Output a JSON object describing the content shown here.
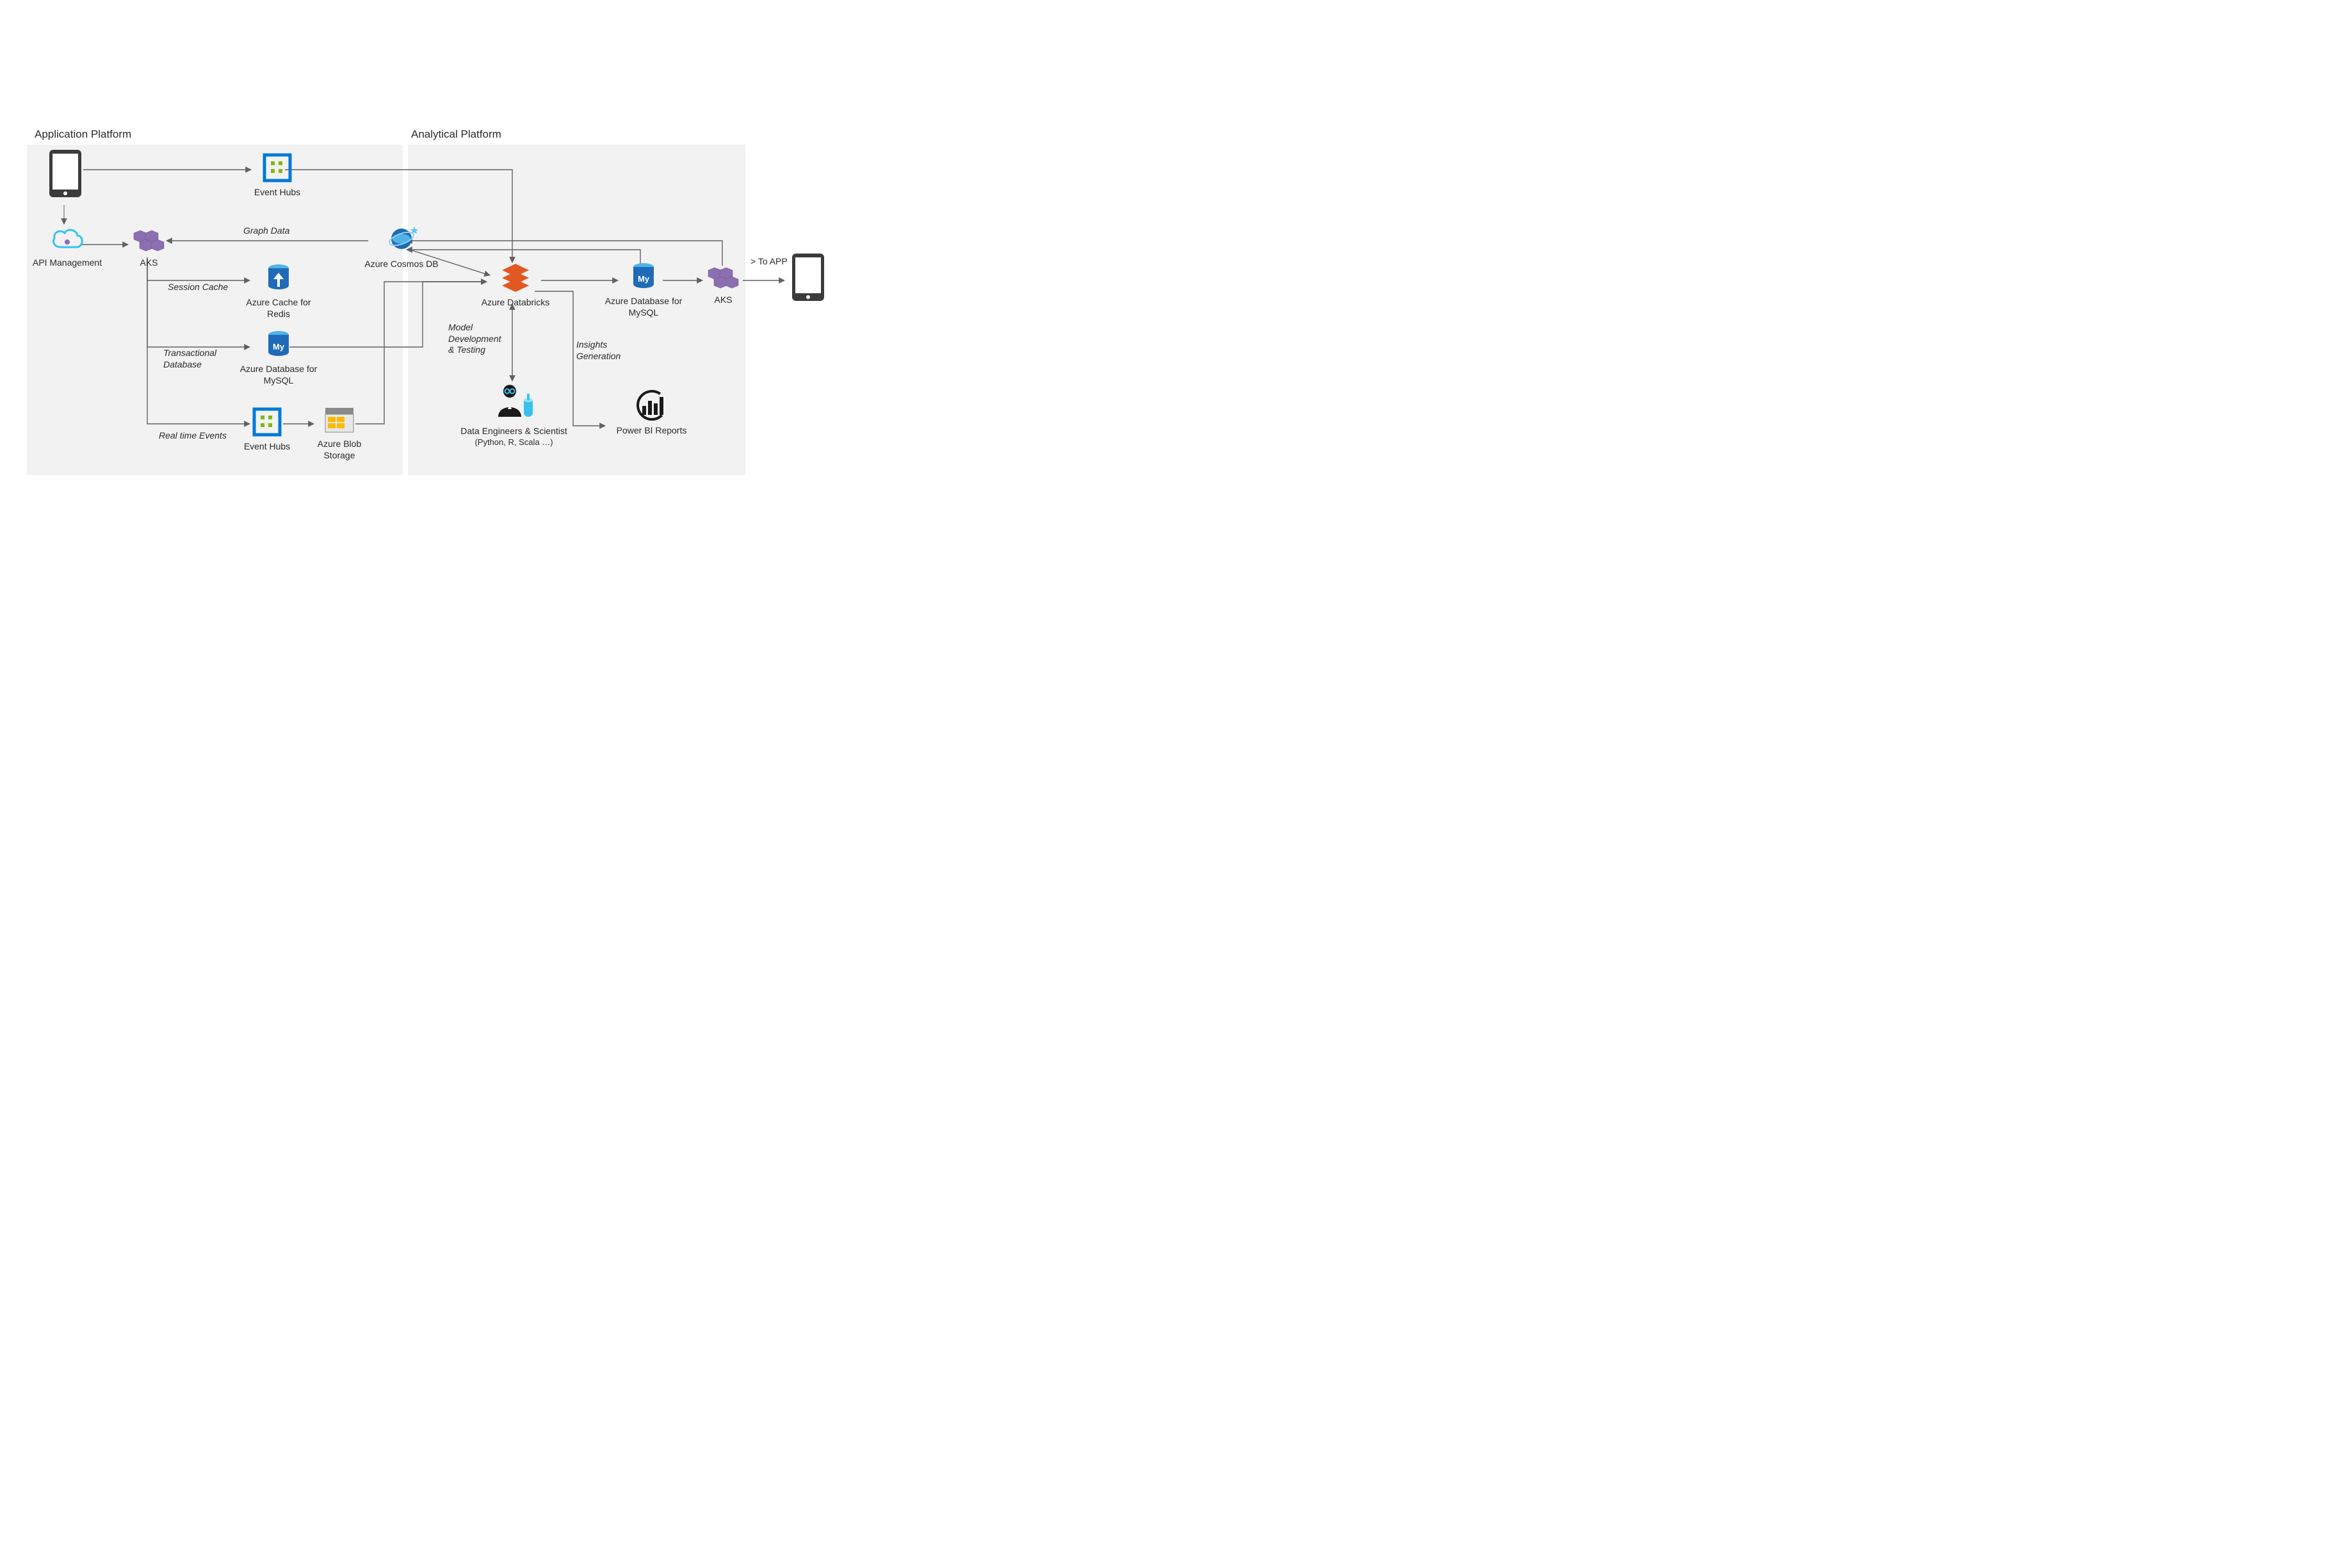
{
  "platforms": {
    "app": "Application Platform",
    "analytical": "Analytical Platform"
  },
  "nodes": {
    "device1": "",
    "apimgmt": "API Management",
    "aks1": "AKS",
    "eventhubs1": "Event Hubs",
    "redis": "Azure Cache for\nRedis",
    "mysql1": "Azure Database for\nMySQL",
    "eventhubs2": "Event Hubs",
    "blob": "Azure Blob\nStorage",
    "cosmos": "Azure Cosmos DB",
    "databricks": "Azure Databricks",
    "mysql2": "Azure Database for\nMySQL",
    "aks2": "AKS",
    "scientist1": "Data Engineers & Scientist",
    "scientist2": "(Python, R, Scala …)",
    "powerbi": "Power BI Reports",
    "device2": "",
    "toapp": "> To APP"
  },
  "edges": {
    "graphdata": "Graph Data",
    "sessioncache": "Session Cache",
    "transdb": "Transactional\nDatabase",
    "realtime": "Real time Events",
    "model": "Model\nDevelopment\n& Testing",
    "insights": "Insights\nGeneration"
  },
  "colors": {
    "azureBlue": "#0078d4",
    "azureCyan": "#37c2ee",
    "green": "#7fba00",
    "orange": "#e25822",
    "yellow": "#ffb900",
    "dbBlue": "#1f6bb7",
    "purple": "#8c6fb1",
    "dark": "#3b3b3b",
    "grey": "#8a8a8a",
    "panel": "#f2f2f2"
  }
}
